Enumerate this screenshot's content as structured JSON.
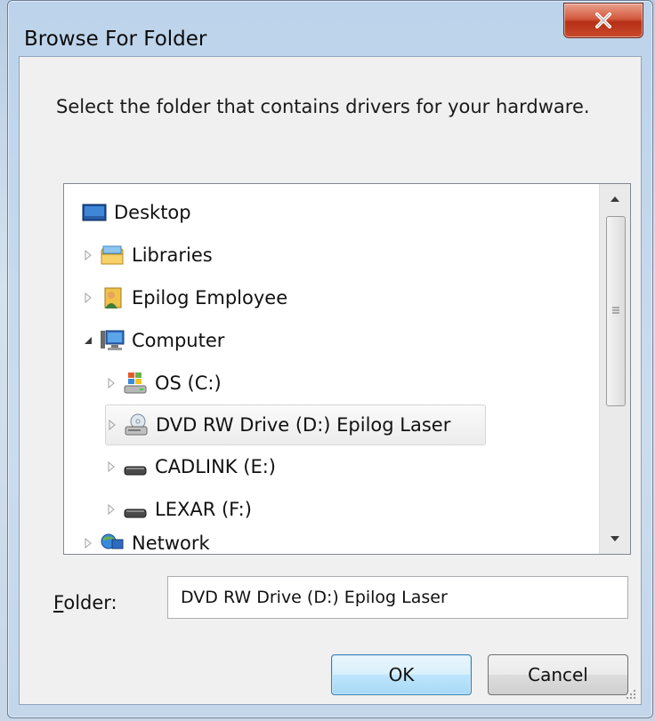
{
  "window": {
    "title": "Browse For Folder",
    "close_glyph": "X"
  },
  "instruction": "Select the folder that contains drivers for your hardware.",
  "tree": {
    "items": [
      {
        "label": "Desktop",
        "icon": "desktop-icon",
        "expander": "none"
      },
      {
        "label": "Libraries",
        "icon": "libraries-icon",
        "expander": "collapsed"
      },
      {
        "label": "Epilog Employee",
        "icon": "user-folder-icon",
        "expander": "collapsed"
      },
      {
        "label": "Computer",
        "icon": "computer-icon",
        "expander": "expanded"
      },
      {
        "label": "OS (C:)",
        "icon": "windows-drive-icon",
        "expander": "collapsed"
      },
      {
        "label": "DVD RW Drive (D:) Epilog Laser",
        "icon": "dvd-drive-icon",
        "expander": "collapsed",
        "selected": true
      },
      {
        "label": "CADLINK (E:)",
        "icon": "removable-drive-icon",
        "expander": "collapsed"
      },
      {
        "label": "LEXAR (F:)",
        "icon": "removable-drive-icon",
        "expander": "collapsed"
      },
      {
        "label": "Network",
        "icon": "network-icon",
        "expander": "collapsed"
      }
    ]
  },
  "folder": {
    "label_accel": "F",
    "label_rest": "older:",
    "value": "DVD RW Drive (D:) Epilog Laser"
  },
  "buttons": {
    "ok": "OK",
    "cancel": "Cancel"
  },
  "colors": {
    "close_button": "#c94a2a",
    "ok_border": "#3c7fb1",
    "selection_border": "#d6d6d6"
  }
}
